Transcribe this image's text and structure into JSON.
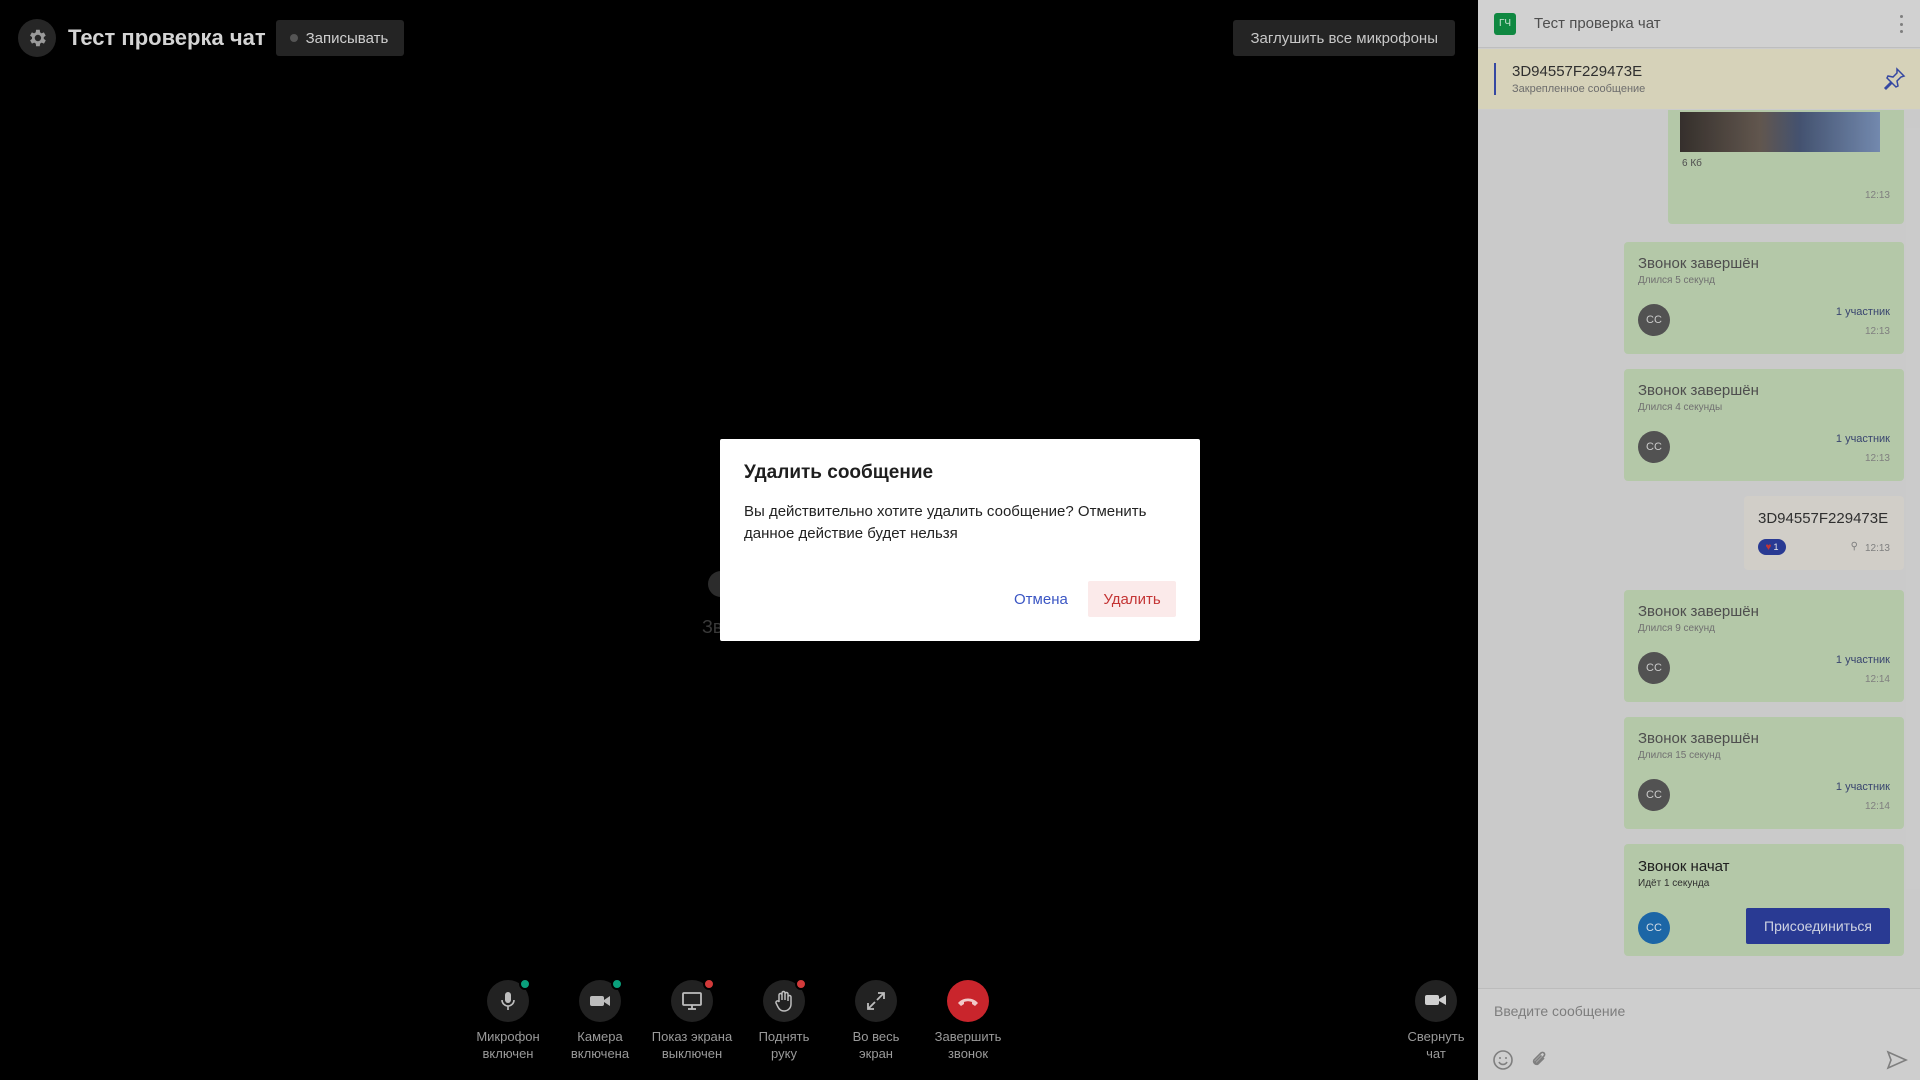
{
  "call": {
    "title": "Тест проверка чат",
    "record_label": "Записывать",
    "mute_all_label": "Заглушить все микрофоны",
    "center_text": "Зв"
  },
  "controls": [
    {
      "label": "Микрофон\nвключен",
      "icon": "microphone-icon",
      "status": "on"
    },
    {
      "label": "Камера\nвключена",
      "icon": "camera-icon",
      "status": "on"
    },
    {
      "label": "Показ экрана\nвыключен",
      "icon": "screen-share-icon",
      "status": "off"
    },
    {
      "label": "Поднять\nруку",
      "icon": "raise-hand-icon",
      "status": "off"
    },
    {
      "label": "Во весь\nэкран",
      "icon": "fullscreen-icon",
      "status": "none"
    },
    {
      "label": "Завершить\nзвонок",
      "icon": "end-call-icon",
      "status": "none"
    },
    {
      "label": "Свернуть\nчат",
      "icon": "collapse-chat-icon",
      "status": "none"
    }
  ],
  "chat": {
    "avatar": "ГЧ",
    "title": "Тест проверка чат",
    "pinned": {
      "title": "3D94557F229473E",
      "subtitle": "Закрепленное сообщение"
    },
    "messages": {
      "image_msg": {
        "size": "6 Кб",
        "time": "12:13"
      },
      "call1": {
        "title": "Звонок завершён",
        "sub": "Длился 5 секунд",
        "avatar": "СС",
        "participants": "1 участник",
        "time": "12:13"
      },
      "call2": {
        "title": "Звонок завершён",
        "sub": "Длился 4 секунды",
        "avatar": "СС",
        "participants": "1 участник",
        "time": "12:13"
      },
      "text_msg": {
        "text": "3D94557F229473E",
        "reaction_count": "1",
        "time": "12:13"
      },
      "call3": {
        "title": "Звонок завершён",
        "sub": "Длился 9 секунд",
        "avatar": "СС",
        "participants": "1 участник",
        "time": "12:14"
      },
      "call4": {
        "title": "Звонок завершён",
        "sub": "Длился 15 секунд",
        "avatar": "СС",
        "participants": "1 участник",
        "time": "12:14"
      },
      "call5": {
        "title": "Звонок начат",
        "sub": "Идёт 1 секунда",
        "avatar": "СС",
        "join_label": "Присоединиться"
      }
    },
    "composer": {
      "placeholder": "Введите сообщение"
    }
  },
  "dialog": {
    "title": "Удалить сообщение",
    "text": "Вы действительно хотите удалить сообщение? Отменить данное действие будет нельзя",
    "cancel_label": "Отмена",
    "delete_label": "Удалить"
  },
  "colors": {
    "accent": "#3b56c4",
    "danger": "#c9252c",
    "status_on": "#0aa07c",
    "status_off": "#d23a3a",
    "call_bubble": "#c4d9b7"
  }
}
